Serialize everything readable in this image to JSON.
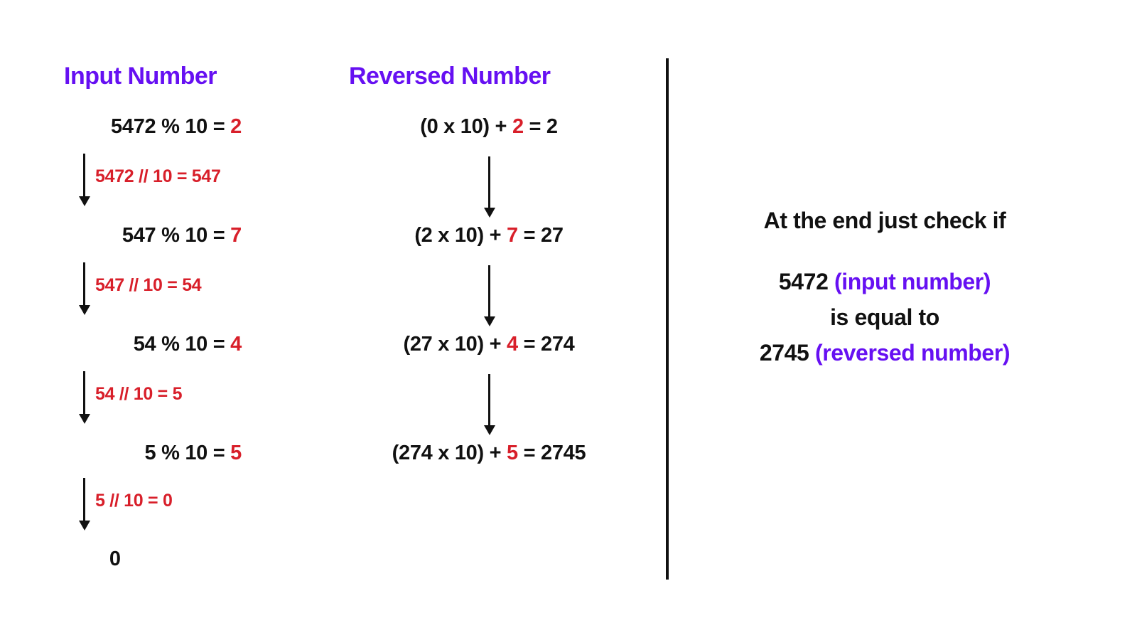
{
  "colors": {
    "accent_purple": "#6610f2",
    "highlight_red": "#d81f2a",
    "text_black": "#111111",
    "background": "#ffffff"
  },
  "columns": {
    "input": {
      "heading": "Input Number"
    },
    "reversed": {
      "heading": "Reversed Number"
    }
  },
  "input_steps": [
    {
      "expr": "5472 % 10 = ",
      "digit": "2",
      "note": "5472 // 10 = 547"
    },
    {
      "expr": "547 % 10 = ",
      "digit": "7",
      "note": "547 // 10 = 54"
    },
    {
      "expr": "54 % 10 = ",
      "digit": "4",
      "note": "54 // 10 = 5"
    },
    {
      "expr": "5 % 10 = ",
      "digit": "5",
      "note": "5 // 10 = 0"
    }
  ],
  "input_final": "0",
  "reversed_steps": [
    {
      "prefix": "(0 x 10) + ",
      "digit": "2",
      "suffix": " =  2"
    },
    {
      "prefix": "(2 x 10) + ",
      "digit": "7",
      "suffix": " =  27"
    },
    {
      "prefix": "(27 x 10) + ",
      "digit": "4",
      "suffix": " =  274"
    },
    {
      "prefix": "(274 x 10) + ",
      "digit": "5",
      "suffix": " =  2745"
    }
  ],
  "conclusion": {
    "heading": "At the end just check if",
    "line1_number": "5472 ",
    "line1_label": "(input number)",
    "line2": "is equal to",
    "line3_number": "2745 ",
    "line3_label": "(reversed number)"
  }
}
